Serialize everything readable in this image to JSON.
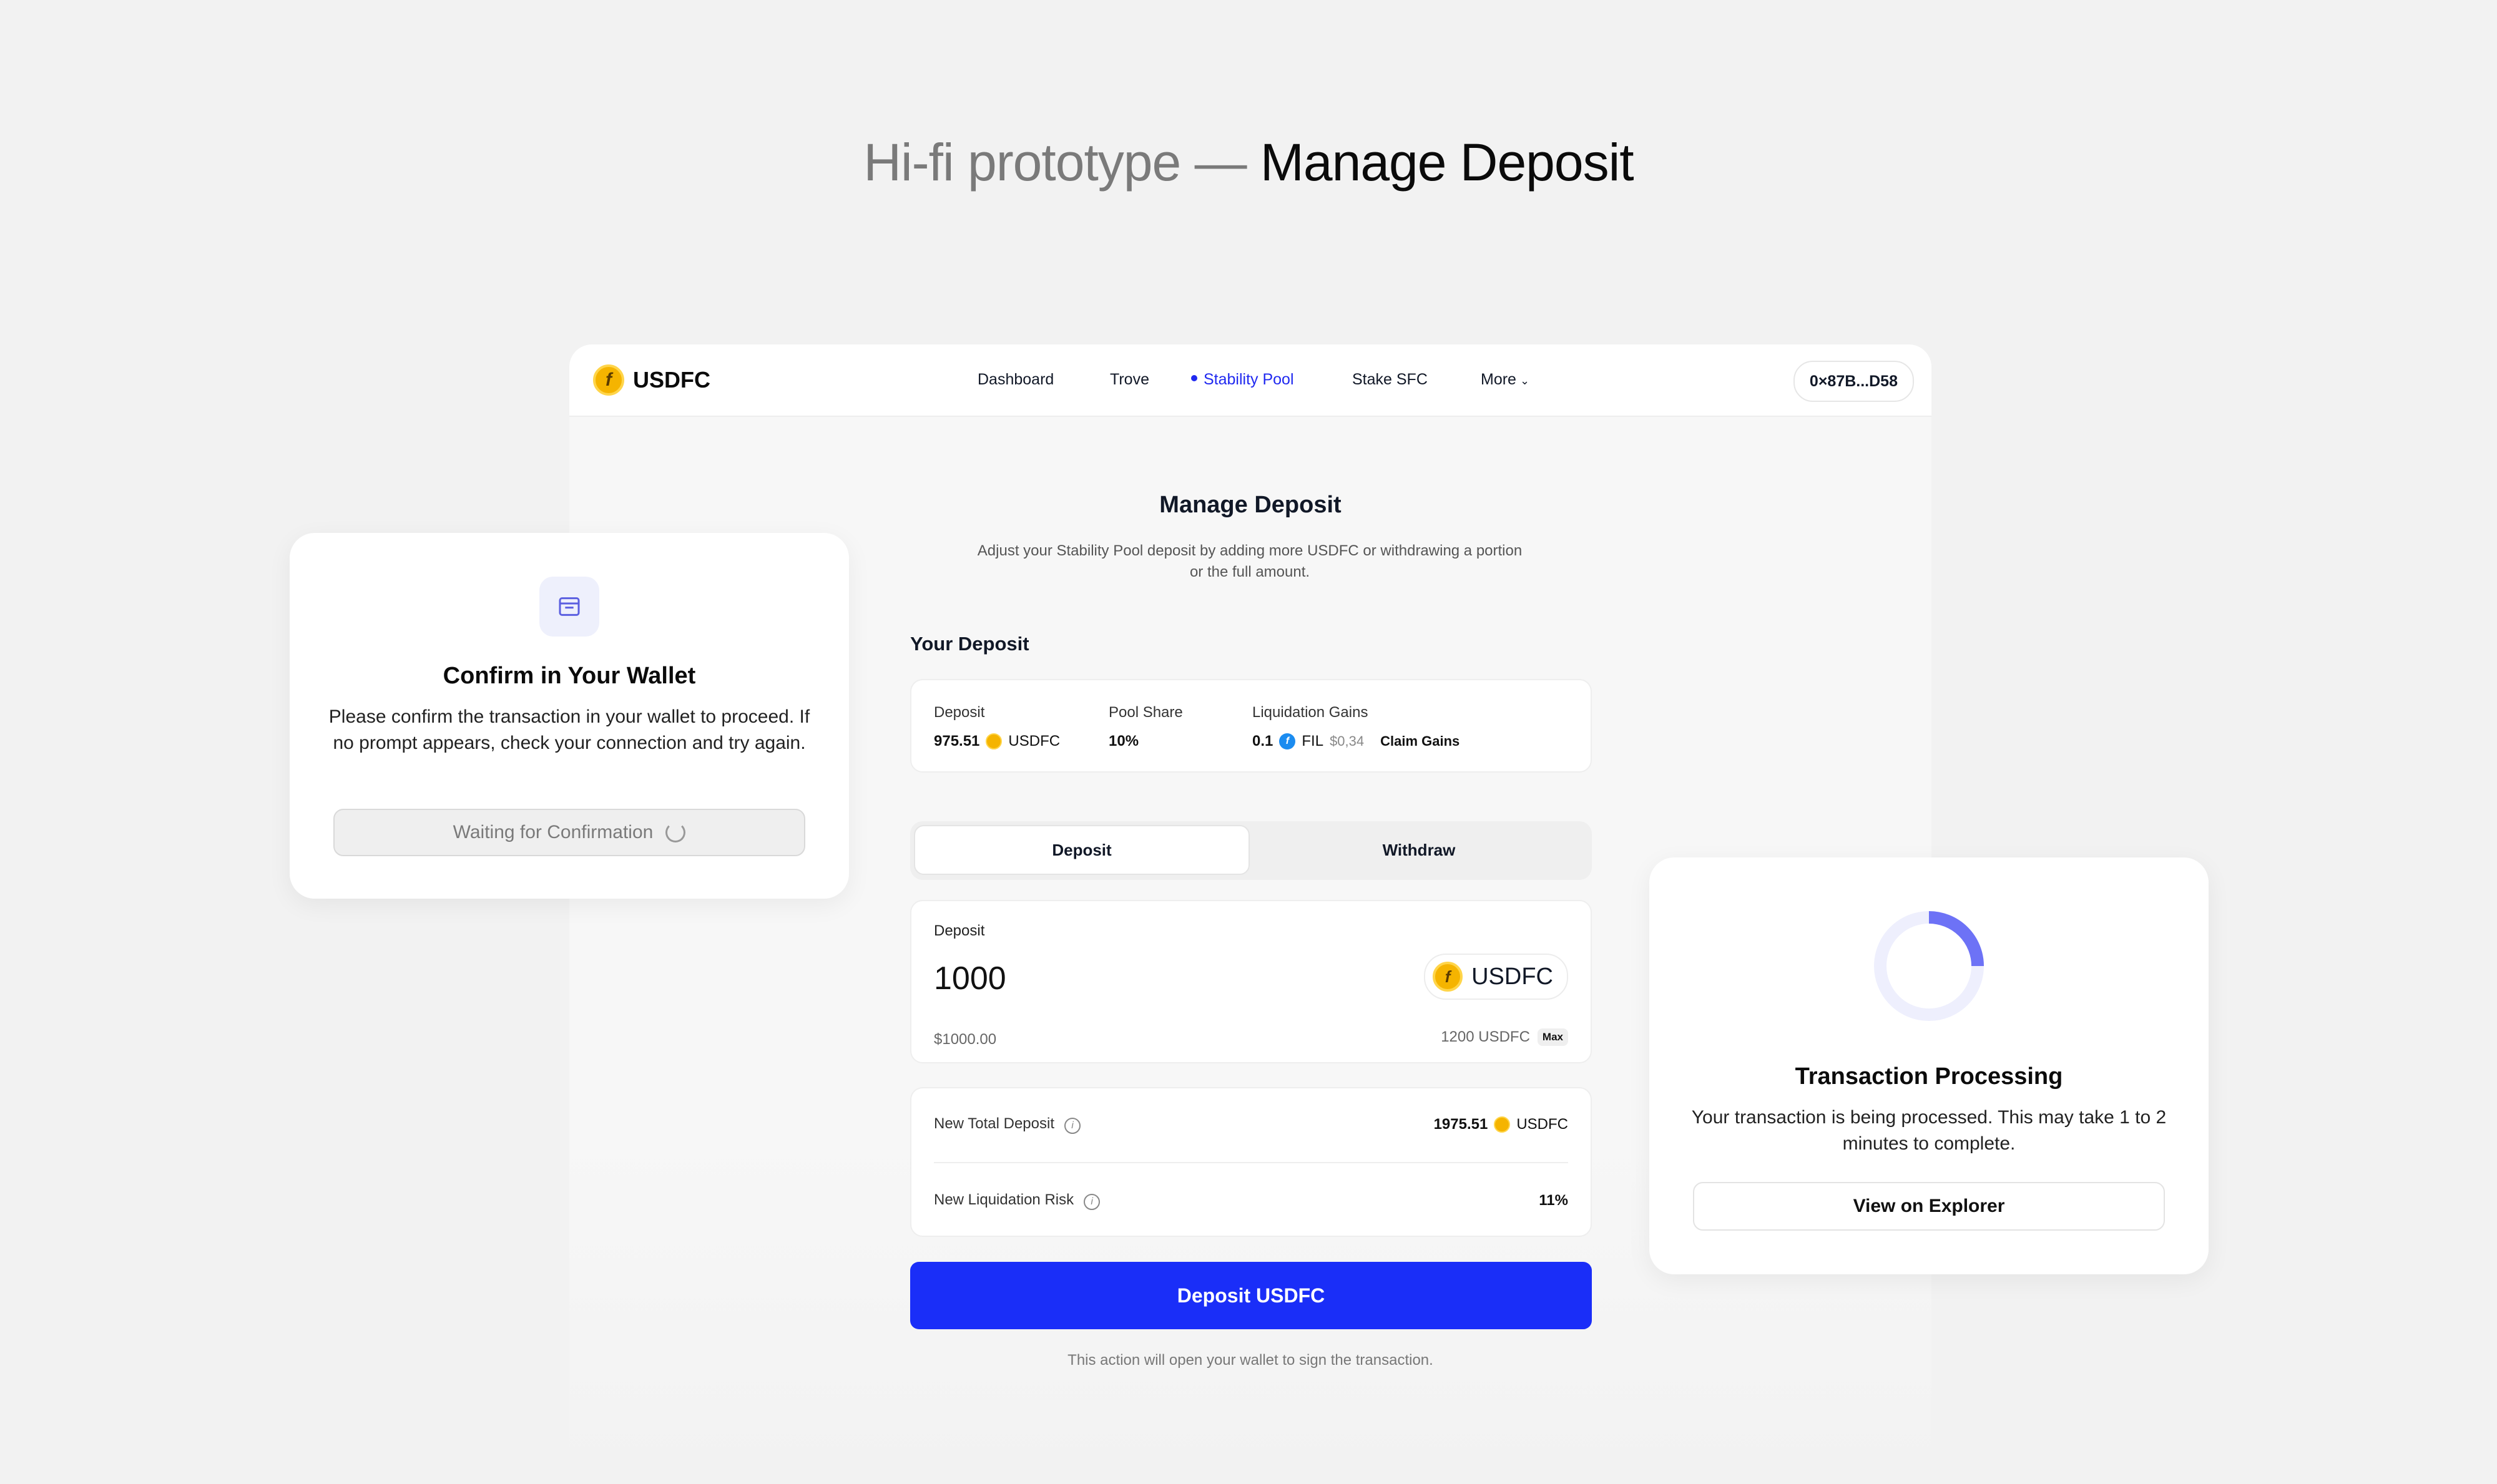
{
  "heading": {
    "prefix": "Hi-fi prototype — ",
    "main": "Manage Deposit"
  },
  "app": {
    "logo_text": "USDFC",
    "nav": [
      "Dashboard",
      "Trove",
      "Stability Pool",
      "Stake SFC",
      "More"
    ],
    "active_nav": "Stability Pool",
    "wallet_address": "0×87B...D58"
  },
  "page": {
    "title": "Manage Deposit",
    "subtitle": "Adjust your Stability Pool deposit by adding more USDFC or withdrawing a portion or the full amount.",
    "your_deposit_label": "Your Deposit"
  },
  "your_deposit": {
    "deposit_label": "Deposit",
    "deposit_value": "975.51",
    "deposit_token": "USDFC",
    "pool_share_label": "Pool Share",
    "pool_share_value": "10%",
    "liq_gains_label": "Liquidation Gains",
    "liq_gains_value": "0.1",
    "liq_gains_token": "FIL",
    "liq_gains_usd": "$0,34",
    "claim_label": "Claim Gains"
  },
  "tabs": {
    "deposit": "Deposit",
    "withdraw": "Withdraw",
    "selected": "Deposit"
  },
  "deposit_input": {
    "label": "Deposit",
    "amount": "1000",
    "token": "USDFC",
    "usd_value": "$1000.00",
    "balance": "1200 USDFC",
    "max_label": "Max"
  },
  "summary": {
    "new_total_label": "New Total Deposit",
    "new_total_value": "1975.51",
    "new_total_token": "USDFC",
    "new_risk_label": "New Liquidation Risk",
    "new_risk_value": "11%"
  },
  "action": {
    "button": "Deposit USDFC",
    "footnote": "This action will open your wallet to sign the transaction."
  },
  "confirm_modal": {
    "title": "Confirm in Your Wallet",
    "text": "Please confirm the transaction in your wallet to proceed. If no prompt appears, check your connection and try again.",
    "button": "Waiting for Confirmation"
  },
  "processing_modal": {
    "title": "Transaction Processing",
    "text": "Your transaction is being processed. This may take 1 to 2 minutes to complete.",
    "button": "View on Explorer",
    "progress": 0.25
  },
  "colors": {
    "accent": "#1a2ef8",
    "nav_active": "#2029f0",
    "coin": "#f5b400",
    "fil": "#1b8cf0",
    "ring": "#6d72f6"
  }
}
